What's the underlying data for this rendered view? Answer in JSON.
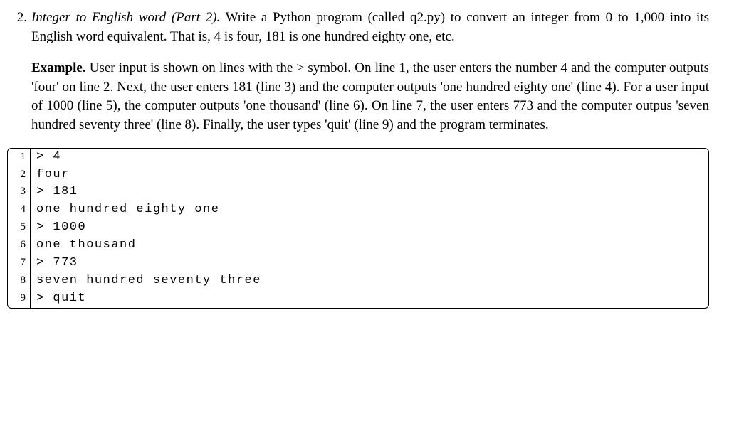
{
  "item": {
    "number": "2.",
    "title": "Integer to English word (Part 2).",
    "intro_rest": "  Write a Python program (called q2.py) to convert an integer from 0 to 1,000 into its English word equivalent.  That is, 4 is four, 181 is one hundred eighty one, etc."
  },
  "example": {
    "label": "Example.",
    "text": "   User input is shown on lines with the > symbol.  On line 1, the user enters the number 4 and the computer outputs 'four' on line 2.  Next, the user enters 181 (line 3) and the computer outputs 'one hundred eighty one' (line 4).  For a user input of 1000 (line 5), the computer outputs 'one thousand' (line 6).  On line 7, the user enters 773 and the computer outpus 'seven hundred seventy three' (line 8).  Finally, the user types 'quit' (line 9) and the program terminates."
  },
  "code": {
    "lines": [
      {
        "n": "1",
        "text": "> 4"
      },
      {
        "n": "2",
        "text": "four"
      },
      {
        "n": "3",
        "text": "> 181"
      },
      {
        "n": "4",
        "text": "one hundred eighty one"
      },
      {
        "n": "5",
        "text": "> 1000"
      },
      {
        "n": "6",
        "text": "one thousand"
      },
      {
        "n": "7",
        "text": "> 773"
      },
      {
        "n": "8",
        "text": "seven hundred seventy three"
      },
      {
        "n": "9",
        "text": "> quit"
      }
    ]
  }
}
